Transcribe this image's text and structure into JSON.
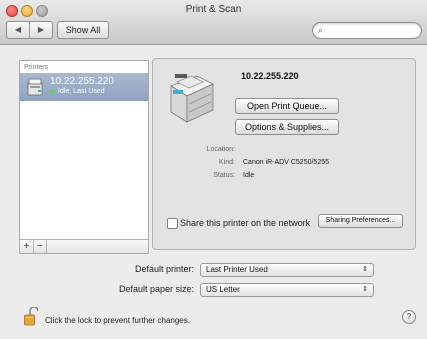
{
  "window": {
    "title": "Print & Scan"
  },
  "toolbar": {
    "back_glyph": "◀",
    "forward_glyph": "▶",
    "show_all_label": "Show All",
    "search_icon": "⌕",
    "search_value": ""
  },
  "printers": {
    "header": "Printers",
    "items": [
      {
        "name": "10.22.255.220",
        "status": "Idle, Last Used"
      }
    ],
    "add_label": "+",
    "remove_label": "−"
  },
  "details": {
    "name": "10.22.255.220",
    "open_queue_label": "Open Print Queue...",
    "options_label": "Options & Supplies...",
    "location_label": "Location:",
    "location_value": "",
    "kind_label": "Kind:",
    "kind_value": "Canon iR-ADV C5250/5255",
    "status_label": "Status:",
    "status_value": "Idle",
    "share_label": "Share this printer on the network",
    "share_checked": false,
    "sharing_prefs_label": "Sharing Preferences..."
  },
  "defaults": {
    "printer_label": "Default printer:",
    "printer_value": "Last Printer Used",
    "paper_label": "Default paper size:",
    "paper_value": "US Letter",
    "popup_arrows": "⇕"
  },
  "footer": {
    "lock_text": "Click the lock to prevent further changes.",
    "help_label": "?"
  },
  "colors": {
    "selection": "#9aabc6",
    "status_idle": "#5fd35f"
  }
}
